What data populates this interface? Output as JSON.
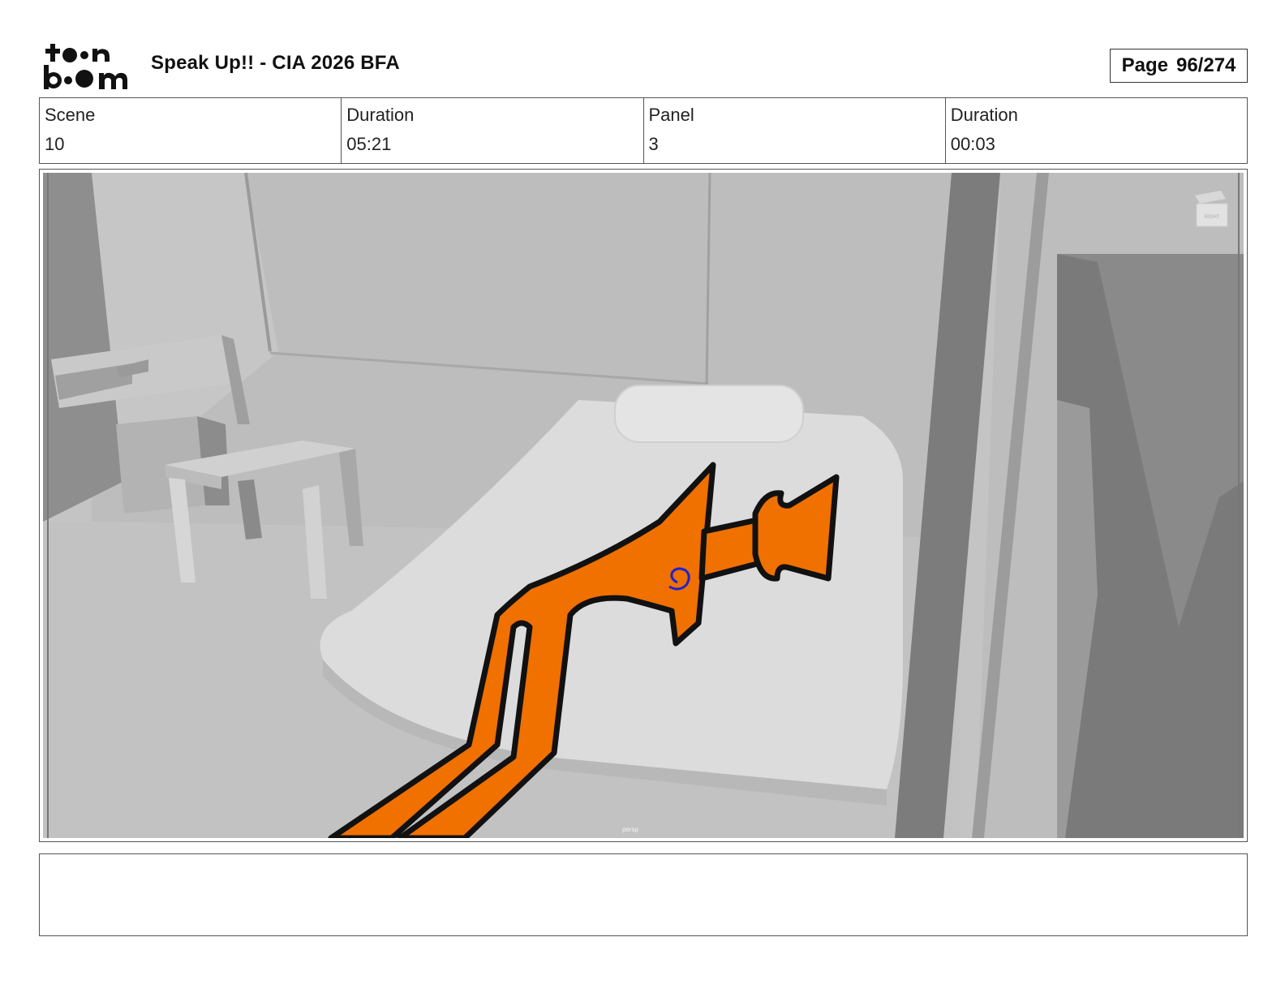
{
  "header": {
    "logo_text_top": "toon",
    "logo_text_bottom": "boom",
    "project_title": "Speak Up!! - CIA 2026 BFA",
    "page_label": "Page",
    "page_number": "96/274"
  },
  "info": {
    "scene_label": "Scene",
    "scene_value": "10",
    "scene_duration_label": "Duration",
    "scene_duration_value": "05:21",
    "panel_label": "Panel",
    "panel_value": "3",
    "panel_duration_label": "Duration",
    "panel_duration_value": "00:03"
  },
  "panel": {
    "viewport_label": "persp",
    "orientation_cube_label": "RIGHT",
    "character_color": "#F07000",
    "spiral_color": "#2222CC"
  },
  "notes": {
    "text": ""
  }
}
